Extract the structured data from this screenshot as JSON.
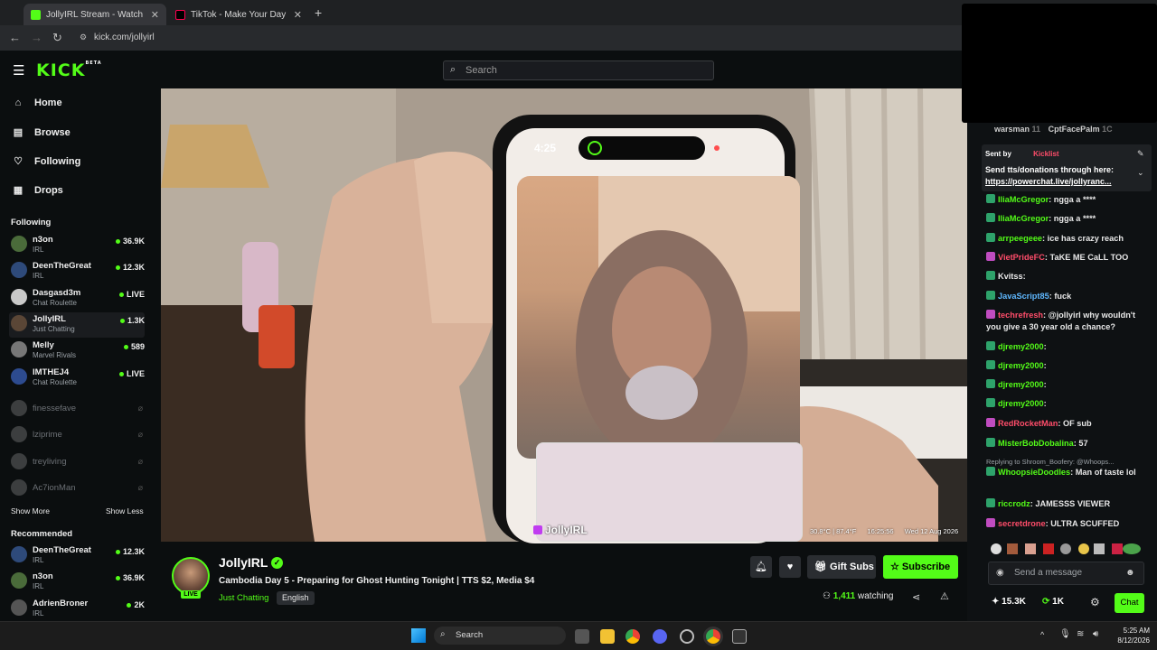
{
  "browser": {
    "tabs": [
      {
        "title": "JollyIRL Stream - Watch Live",
        "active": true
      },
      {
        "title": "TikTok - Make Your Day",
        "active": false
      }
    ],
    "url": "kick.com/jollyirl"
  },
  "header": {
    "logo": "KICK",
    "logo_sup": "BETA",
    "search_placeholder": "Search"
  },
  "sidebar": {
    "nav": [
      {
        "label": "Home",
        "icon": "home-icon"
      },
      {
        "label": "Browse",
        "icon": "browse-icon"
      },
      {
        "label": "Following",
        "icon": "heart-icon"
      },
      {
        "label": "Drops",
        "icon": "drops-icon"
      }
    ],
    "following_title": "Following",
    "following": [
      {
        "name": "n3on",
        "category": "IRL",
        "count": "36.9K",
        "live": true,
        "color": "#4a6b3a"
      },
      {
        "name": "DeenTheGreat",
        "category": "IRL",
        "count": "12.3K",
        "live": true,
        "color": "#2e4a7a"
      },
      {
        "name": "Dasgasd3m",
        "category": "Chat Roulette",
        "count": "LIVE",
        "live": true,
        "color": "#c9c9c9"
      },
      {
        "name": "JollyIRL",
        "category": "Just Chatting",
        "count": "1.3K",
        "live": true,
        "color": "#5a4636"
      },
      {
        "name": "Melly",
        "category": "Marvel Rivals",
        "count": "589",
        "live": true,
        "color": "#777777"
      },
      {
        "name": "IMTHEJ4",
        "category": "Chat Roulette",
        "count": "LIVE",
        "live": true,
        "color": "#2d4b8f"
      },
      {
        "name": "finessefave",
        "category": "",
        "count": "",
        "live": false,
        "color": "#888888"
      },
      {
        "name": "lziprime",
        "category": "",
        "count": "",
        "live": false,
        "color": "#888888"
      },
      {
        "name": "treyliving",
        "category": "",
        "count": "",
        "live": false,
        "color": "#888888"
      },
      {
        "name": "Ac7ionMan",
        "category": "",
        "count": "",
        "live": false,
        "color": "#888888"
      }
    ],
    "show_more": "Show More",
    "show_less": "Show Less",
    "recommended_title": "Recommended",
    "recommended": [
      {
        "name": "DeenTheGreat",
        "category": "IRL",
        "count": "12.3K",
        "color": "#2e4a7a"
      },
      {
        "name": "n3on",
        "category": "IRL",
        "count": "36.9K",
        "color": "#4a6b3a"
      },
      {
        "name": "AdrienBroner",
        "category": "IRL",
        "count": "2K",
        "color": "#555555"
      }
    ]
  },
  "video": {
    "phone_time": "4:25",
    "watermark": "JollyIRL",
    "overlay_temp": "30.8°C | 87.4°F",
    "overlay_time": "16:25:56",
    "overlay_date": "Wed 12 Aug 2026"
  },
  "stream": {
    "streamer": "JollyIRL",
    "live_label": "LIVE",
    "title": "Cambodia Day 5 - Preparing for Ghost Hunting Tonight | TTS $2, Media $4",
    "category": "Just Chatting",
    "language": "English",
    "gift_label": "Gift Subs",
    "subscribe_label": "Subscribe",
    "watching_count": "1,411",
    "watching_label": "watching"
  },
  "chat": {
    "top_users": [
      {
        "name": "warsman",
        "count": "11"
      },
      {
        "name": "CptFacePalm",
        "count": "1C"
      }
    ],
    "pinned": {
      "sent_by": "Sent by",
      "sender": "Kicklist",
      "text": "Send tts/donations through here:",
      "link": "https://powerchat.live/jollyranc..."
    },
    "messages": [
      {
        "user": "IliaMcGregor",
        "text": "ngga a ****",
        "color": "#53fc18"
      },
      {
        "user": "IliaMcGregor",
        "text": "ngga a ****",
        "color": "#53fc18"
      },
      {
        "user": "arrpeegeee",
        "text": "ice has crazy reach",
        "color": "#53fc18"
      },
      {
        "user": "VietPrideFC",
        "text": "TaKE ME CaLL TOO",
        "color": "#ff4d6a"
      },
      {
        "user": "Kvitss",
        "text": "",
        "color": "#e8e8e8"
      },
      {
        "user": "JavaScript85",
        "text": "fuck",
        "color": "#5fb8ff"
      },
      {
        "user": "techrefresh",
        "text": "@jollyirl why wouldn't you give a 30 year old a chance?",
        "color": "#ff4d6a"
      },
      {
        "user": "djremy2000",
        "text": "",
        "color": "#53fc18"
      },
      {
        "user": "djremy2000",
        "text": "",
        "color": "#53fc18"
      },
      {
        "user": "djremy2000",
        "text": "",
        "color": "#53fc18"
      },
      {
        "user": "djremy2000",
        "text": "",
        "color": "#53fc18"
      },
      {
        "user": "RedRocketMan",
        "text": "OF sub",
        "color": "#ff4d6a"
      },
      {
        "user": "MisterBobDobalina",
        "text": "57",
        "color": "#53fc18"
      },
      {
        "user": "WhoopsieDoodles",
        "text": "Man of taste lol",
        "color": "#53fc18",
        "reply": "Replying to Shroom_Boofery: @Whoops..."
      },
      {
        "user": "riccrodz",
        "text": "JAMESSS VIEWER",
        "color": "#53fc18"
      },
      {
        "user": "secretdrone",
        "text": "ULTRA SCUFFED",
        "color": "#ff4d6a"
      }
    ],
    "input_placeholder": "Send a message",
    "followers": "15.3K",
    "points": "1K",
    "chat_button": "Chat"
  },
  "taskbar": {
    "search": "Search",
    "time": "5:25 AM",
    "date": "8/12/2026"
  }
}
